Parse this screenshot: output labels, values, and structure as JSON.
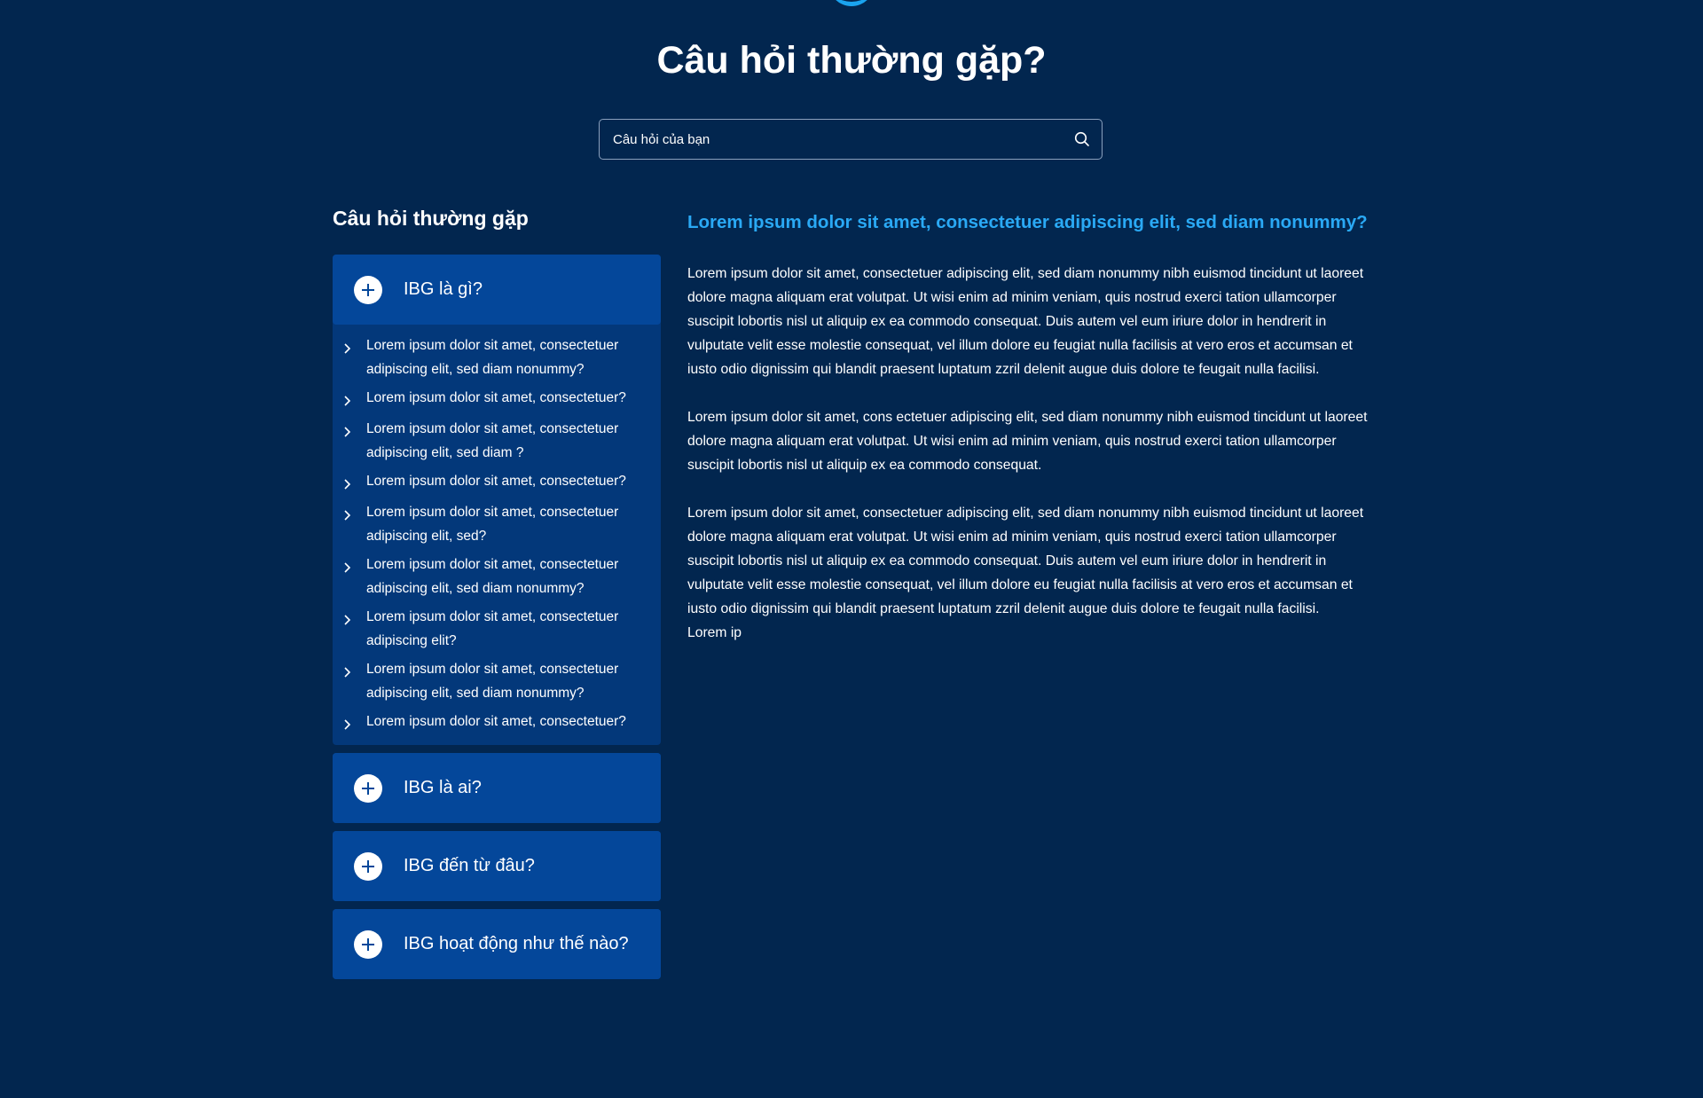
{
  "colors": {
    "background": "#02264f",
    "panel": "#04479a",
    "panel_open": "#03387a",
    "accent": "#2aa9f5"
  },
  "header": {
    "title": "Câu hỏi thường gặp?"
  },
  "search": {
    "placeholder": "Câu hỏi của bạn",
    "icon": "search-icon"
  },
  "sidebar": {
    "title": "Câu hỏi thường gặp",
    "groups": [
      {
        "label": "IBG là gì?",
        "icon": "plus-icon",
        "expanded": true,
        "items": [
          "Lorem ipsum dolor sit amet, consectetuer adipiscing elit, sed diam nonummy?",
          "Lorem ipsum dolor sit amet, consectetuer?",
          "Lorem ipsum dolor sit amet, consectetuer adipiscing elit, sed diam ?",
          "Lorem ipsum dolor sit amet, consectetuer?",
          "Lorem ipsum dolor sit amet, consectetuer adipiscing elit, sed?",
          "Lorem ipsum dolor sit amet, consectetuer adipiscing elit, sed diam nonummy?",
          "Lorem ipsum dolor sit amet, consectetuer adipiscing elit?",
          "Lorem ipsum dolor sit amet, consectetuer adipiscing elit, sed diam nonummy?",
          "Lorem ipsum dolor sit amet, consectetuer?"
        ]
      },
      {
        "label": "IBG là ai?",
        "icon": "plus-icon",
        "expanded": false
      },
      {
        "label": "IBG đến từ đâu?",
        "icon": "plus-icon",
        "expanded": false
      },
      {
        "label": "IBG hoạt động như thế nào?",
        "icon": "plus-icon",
        "expanded": false
      }
    ]
  },
  "content": {
    "title": "Lorem ipsum dolor sit amet, consectetuer adipiscing elit, sed diam nonummy?",
    "paragraphs": [
      "Lorem ipsum dolor sit amet, consectetuer adipiscing elit, sed diam nonummy nibh euismod tincidunt ut laoreet dolore magna aliquam erat volutpat. Ut wisi enim ad minim veniam, quis nostrud exerci tation ullamcorper suscipit lobortis nisl ut aliquip ex ea commodo consequat. Duis autem vel eum iriure dolor in hendrerit in vulputate velit esse molestie consequat, vel illum dolore eu feugiat nulla facilisis at vero eros et accumsan et iusto odio dignissim qui blandit praesent luptatum zzril delenit augue duis dolore te feugait nulla facilisi.",
      "Lorem ipsum dolor sit amet, cons ectetuer adipiscing elit, sed diam nonummy nibh euismod tincidunt ut laoreet dolore magna aliquam erat volutpat. Ut wisi enim ad minim veniam, quis nostrud exerci tation ullamcorper suscipit lobortis nisl ut aliquip ex ea commodo consequat.",
      "Lorem ipsum dolor sit amet, consectetuer adipiscing elit, sed diam nonummy nibh euismod tincidunt ut laoreet dolore magna aliquam erat volutpat. Ut wisi enim ad minim veniam, quis nostrud exerci tation ullamcorper suscipit lobortis nisl ut aliquip ex ea commodo consequat. Duis autem vel eum iriure dolor in hendrerit in vulputate velit esse molestie consequat, vel illum dolore eu feugiat nulla facilisis at vero eros et accumsan et iusto odio dignissim qui blandit praesent luptatum zzril delenit augue duis dolore te feugait nulla facilisi.",
      "Lorem ip"
    ]
  }
}
